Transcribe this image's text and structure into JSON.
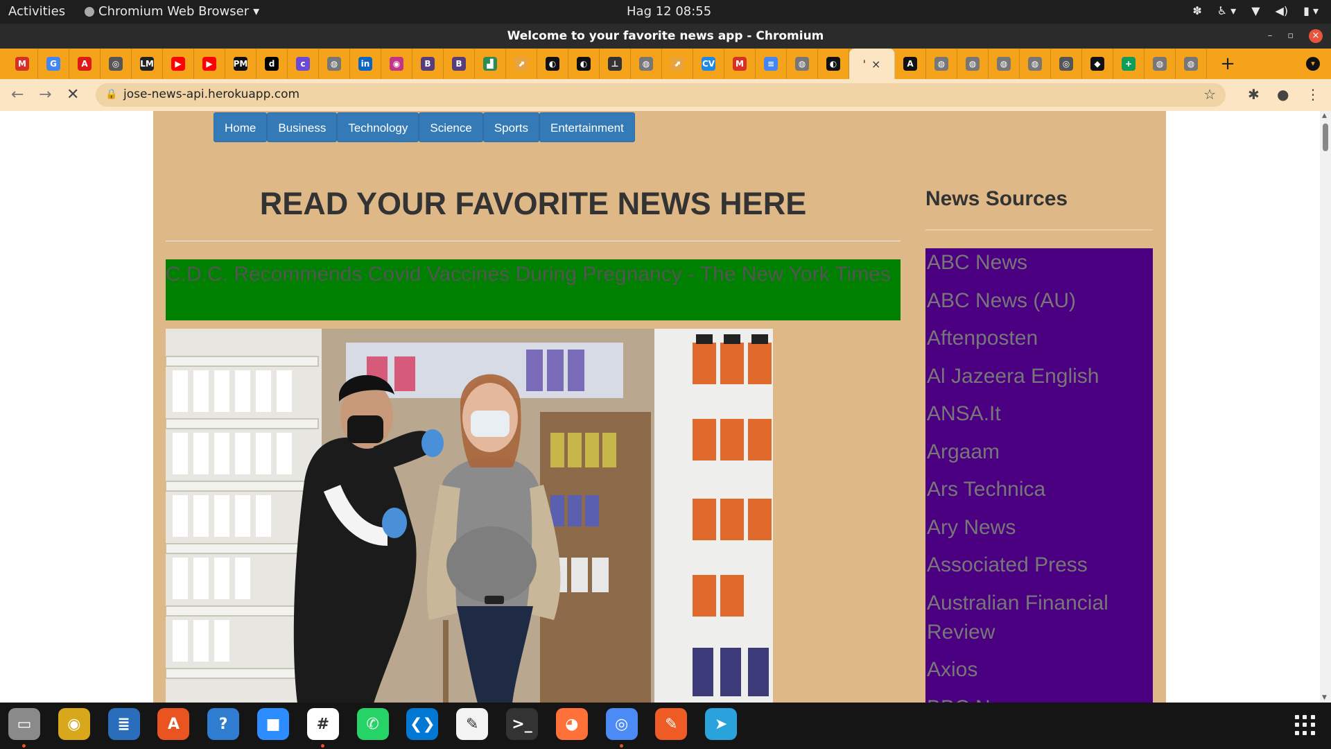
{
  "system_bar": {
    "activities": "Activities",
    "app_menu": "Chromium Web Browser",
    "clock": "Hag 12  08:55"
  },
  "window": {
    "title": "Welcome to your favorite news app - Chromium"
  },
  "tabs": [
    {
      "icon": "gmail-icon",
      "glyph": "M",
      "color": "#d93025"
    },
    {
      "icon": "google-icon",
      "glyph": "G",
      "color": "#4285f4"
    },
    {
      "icon": "angular-icon",
      "glyph": "A",
      "color": "#dd1b16"
    },
    {
      "icon": "chrome-icon",
      "glyph": "◎",
      "color": "#555555"
    },
    {
      "icon": "app-icon",
      "glyph": "LM",
      "color": "#222222"
    },
    {
      "icon": "youtube-icon",
      "glyph": "▶",
      "color": "#ff0000"
    },
    {
      "icon": "youtube-icon",
      "glyph": "▶",
      "color": "#ff0000"
    },
    {
      "icon": "pm-icon",
      "glyph": "PM",
      "color": "#111111"
    },
    {
      "icon": "dev-icon",
      "glyph": "d",
      "color": "#000000"
    },
    {
      "icon": "colorlib-icon",
      "glyph": "c",
      "color": "#6b4bd6"
    },
    {
      "icon": "globe-icon",
      "glyph": "◍",
      "color": "#777777"
    },
    {
      "icon": "linkedin-icon",
      "glyph": "in",
      "color": "#0a66c2"
    },
    {
      "icon": "instagram-icon",
      "glyph": "◉",
      "color": "#c13584"
    },
    {
      "icon": "bootstrap-icon",
      "glyph": "B",
      "color": "#563d7c"
    },
    {
      "icon": "bootstrap-icon",
      "glyph": "B",
      "color": "#563d7c"
    },
    {
      "icon": "chart-icon",
      "glyph": "▟",
      "color": "#2e8b57"
    },
    {
      "icon": "folder-icon",
      "glyph": "⬈",
      "color": "#e8a33d"
    },
    {
      "icon": "github-icon",
      "glyph": "◐",
      "color": "#111111"
    },
    {
      "icon": "github-icon",
      "glyph": "◐",
      "color": "#111111"
    },
    {
      "icon": "pin-icon",
      "glyph": "⊥",
      "color": "#333333"
    },
    {
      "icon": "globe-icon",
      "glyph": "◍",
      "color": "#777777"
    },
    {
      "icon": "folder-icon",
      "glyph": "⬈",
      "color": "#e8a33d"
    },
    {
      "icon": "cv-icon",
      "glyph": "CV",
      "color": "#1e88e5"
    },
    {
      "icon": "gmail-icon",
      "glyph": "M",
      "color": "#d93025"
    },
    {
      "icon": "docs-icon",
      "glyph": "≡",
      "color": "#4285f4"
    },
    {
      "icon": "globe-icon",
      "glyph": "◍",
      "color": "#777777"
    },
    {
      "icon": "github-icon",
      "glyph": "◐",
      "color": "#111111"
    }
  ],
  "tabs_after": [
    {
      "icon": "a-icon",
      "glyph": "A",
      "color": "#111111"
    },
    {
      "icon": "globe-icon",
      "glyph": "◍",
      "color": "#777777"
    },
    {
      "icon": "globe-icon",
      "glyph": "◍",
      "color": "#777777"
    },
    {
      "icon": "globe-icon",
      "glyph": "◍",
      "color": "#777777"
    },
    {
      "icon": "globe-icon",
      "glyph": "◍",
      "color": "#777777"
    },
    {
      "icon": "chrome-icon",
      "glyph": "◎",
      "color": "#555555"
    },
    {
      "icon": "graduation-cap-icon",
      "glyph": "◆",
      "color": "#111111"
    },
    {
      "icon": "plus-square-icon",
      "glyph": "+",
      "color": "#0f9d58"
    },
    {
      "icon": "globe-icon",
      "glyph": "◍",
      "color": "#777777"
    },
    {
      "icon": "globe-icon",
      "glyph": "◍",
      "color": "#777777"
    }
  ],
  "active_tab": {
    "close": "×",
    "loading": "'"
  },
  "toolbar": {
    "url": "jose-news-api.herokuapp.com"
  },
  "nav": [
    "Home",
    "Business",
    "Technology",
    "Science",
    "Sports",
    "Entertainment"
  ],
  "page": {
    "heading": "READ YOUR FAVORITE NEWS HERE",
    "article_title": "C.D.C. Recommends Covid Vaccines During Pregnancy - The New York Times",
    "sidebar_title": "News Sources"
  },
  "sources": [
    "ABC News",
    "ABC News (AU)",
    "Aftenposten",
    "Al Jazeera English",
    "ANSA.It",
    "Argaam",
    "Ars Technica",
    "Ary News",
    "Associated Press",
    "Australian Financial Review",
    "Axios",
    "BBC News"
  ],
  "colors": {
    "tabstrip": "#f6a31c",
    "toolbar": "#fbe5c2",
    "page_bg": "#deb887",
    "nav_button": "#337ab7",
    "article_title_bg": "#008000",
    "sources_bg": "#4b0082"
  },
  "dock": [
    {
      "icon": "files-icon",
      "glyph": "▭",
      "color": "#8a8a8a"
    },
    {
      "icon": "rhythmbox-icon",
      "glyph": "◉",
      "color": "#d8a71b"
    },
    {
      "icon": "writer-icon",
      "glyph": "≣",
      "color": "#2a6ebb"
    },
    {
      "icon": "software-center-icon",
      "glyph": "A",
      "color": "#e95420"
    },
    {
      "icon": "help-icon",
      "glyph": "?",
      "color": "#2f7dd1"
    },
    {
      "icon": "zoom-icon",
      "glyph": "■",
      "color": "#2d8cff"
    },
    {
      "icon": "slack-icon",
      "glyph": "#",
      "color": "#ffffff"
    },
    {
      "icon": "whatsapp-icon",
      "glyph": "✆",
      "color": "#25d366"
    },
    {
      "icon": "vscode-icon",
      "glyph": "❮❯",
      "color": "#0078d4"
    },
    {
      "icon": "text-editor-icon",
      "glyph": "✎",
      "color": "#f3f3f3"
    },
    {
      "icon": "terminal-icon",
      "glyph": ">_",
      "color": "#333333"
    },
    {
      "icon": "firefox-icon",
      "glyph": "◕",
      "color": "#ff7139"
    },
    {
      "icon": "chromium-icon",
      "glyph": "◎",
      "color": "#4c8bf5"
    },
    {
      "icon": "postman-icon",
      "glyph": "✎",
      "color": "#ef5b25"
    },
    {
      "icon": "telegram-icon",
      "glyph": "➤",
      "color": "#2aa3dd"
    }
  ]
}
